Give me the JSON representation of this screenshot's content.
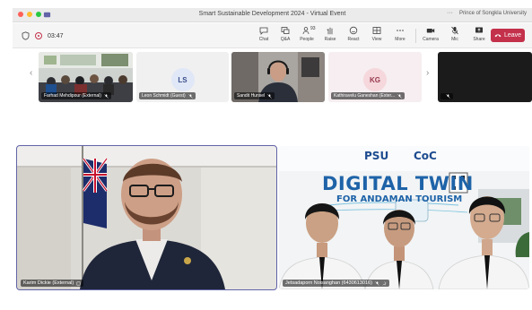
{
  "window": {
    "title": "Smart Sustainable Development 2024 - Virtual Event",
    "more": "···",
    "org": "Prince of Songkla University"
  },
  "toolbar": {
    "timer": "03:47",
    "buttons": [
      {
        "label": "Chat",
        "icon": "chat-icon"
      },
      {
        "label": "Q&A",
        "icon": "qa-icon"
      },
      {
        "label": "People",
        "icon": "people-icon",
        "count": "93"
      },
      {
        "label": "Raise",
        "icon": "hand-icon"
      },
      {
        "label": "React",
        "icon": "smile-icon"
      },
      {
        "label": "View",
        "icon": "grid-icon"
      },
      {
        "label": "More",
        "icon": "more-icon"
      },
      {
        "label": "Camera",
        "icon": "camera-icon"
      },
      {
        "label": "Mic",
        "icon": "mic-icon"
      },
      {
        "label": "Share",
        "icon": "share-icon"
      }
    ],
    "leave": "Leave"
  },
  "strip": {
    "tiles": [
      {
        "name": "Farhad Mehdipour (External)"
      },
      {
        "name": "Leon Schmidt (Guest)",
        "initials": "LS"
      },
      {
        "name": "Sandit Hunsel"
      },
      {
        "name": "Kathiravelu Ganeshan (Exter...",
        "initials": "KG"
      },
      {
        "name": ""
      }
    ]
  },
  "main": {
    "left": {
      "name": "Karim Dickie (External)"
    },
    "right": {
      "name": "Jetsadaporn Noisanghan (6430613016)",
      "brand_psu": "PSU",
      "brand_coc": "CoC",
      "headline": "DIGITAL TWIN",
      "subline": "FOR ANDAMAN TOURISM"
    }
  },
  "colors": {
    "accent": "#6264a7",
    "leave": "#c4314b",
    "ls_avatar_bg": "#e0e7f7",
    "kg_avatar_bg": "#f5d7dc"
  }
}
